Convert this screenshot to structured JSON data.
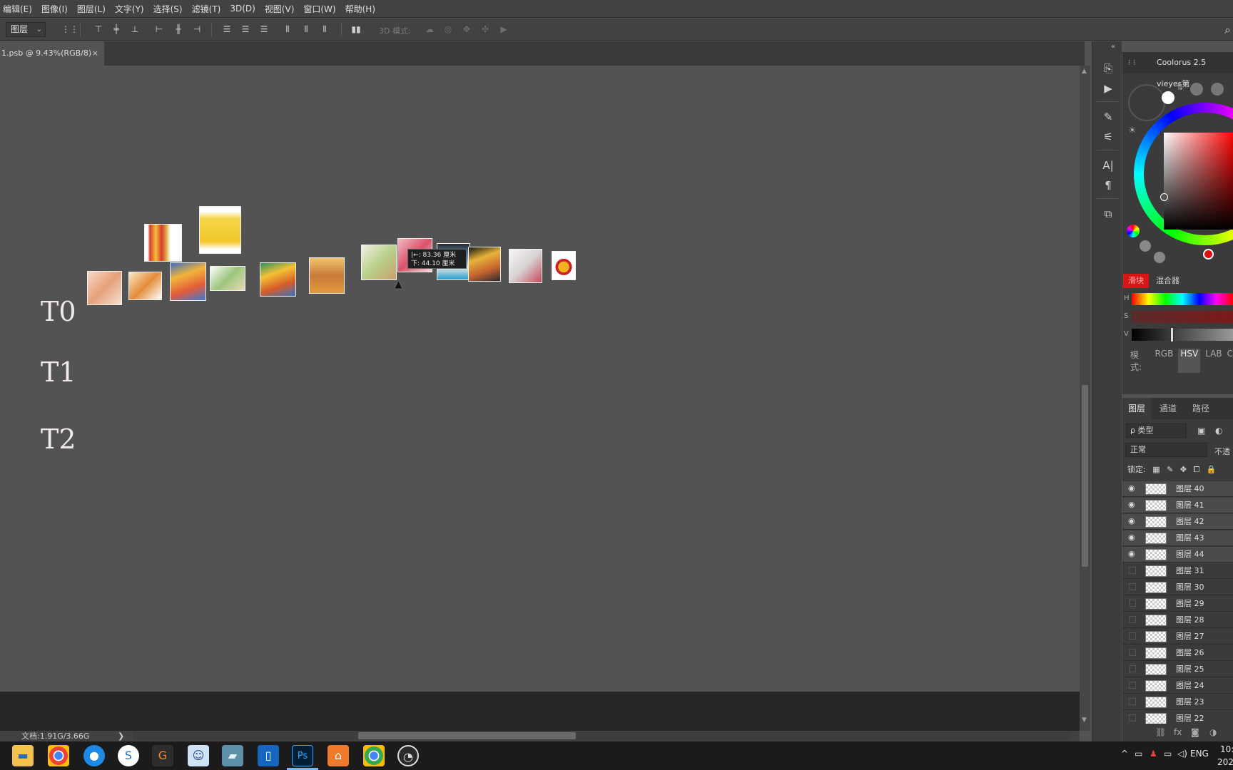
{
  "menu": [
    "编辑(E)",
    "图像(I)",
    "图层(L)",
    "文字(Y)",
    "选择(S)",
    "滤镜(T)",
    "3D(D)",
    "视图(V)",
    "窗口(W)",
    "帮助(H)"
  ],
  "options": {
    "auto_select_target": "图层",
    "mode_3d_label": "3D 模式:"
  },
  "document": {
    "tab_title": "1.psb @ 9.43%(RGB/8)",
    "close_glyph": "×"
  },
  "canvas": {
    "labels": [
      "T0",
      "T1",
      "T2"
    ],
    "tooltip_line1": "|←: 83.36 厘米",
    "tooltip_line2": "下: 44.10 厘米"
  },
  "status": {
    "doc_size": "文档:1.91G/3.66G"
  },
  "color_panel": {
    "title": "Coolorus 2.5 vieyes第",
    "tab_slider": "滑块",
    "tab_mixer": "混合器",
    "slider_labels": [
      "H",
      "S",
      "V"
    ],
    "mode_label": "模式:",
    "modes": [
      "RGB",
      "HSV",
      "LAB",
      "C"
    ],
    "accent": "#d81616"
  },
  "layers_panel": {
    "tabs": [
      "图层",
      "通道",
      "路径"
    ],
    "filter": "ρ 类型",
    "blend_mode": "正常",
    "opacity_label": "不透",
    "lock_label": "锁定:",
    "layers": [
      {
        "name": "图层 40",
        "visible": true
      },
      {
        "name": "图层 41",
        "visible": true
      },
      {
        "name": "图层 42",
        "visible": true
      },
      {
        "name": "图层 43",
        "visible": true
      },
      {
        "name": "图层 44",
        "visible": true
      },
      {
        "name": "图层 31",
        "visible": false
      },
      {
        "name": "图层 30",
        "visible": false
      },
      {
        "name": "图层 29",
        "visible": false
      },
      {
        "name": "图层 28",
        "visible": false
      },
      {
        "name": "图层 27",
        "visible": false
      },
      {
        "name": "图层 26",
        "visible": false
      },
      {
        "name": "图层 25",
        "visible": false
      },
      {
        "name": "图层 24",
        "visible": false
      },
      {
        "name": "图层 23",
        "visible": false
      },
      {
        "name": "图层 22",
        "visible": false
      }
    ]
  },
  "taskbar": {
    "apps": [
      "file-explorer",
      "chrome",
      "app-blue",
      "sogou",
      "grammarly",
      "game-app",
      "notes-app",
      "tablet-app",
      "photoshop",
      "shop-app",
      "chrome-profile",
      "obs"
    ],
    "tray_lang": "ENG",
    "clock_time": "10:",
    "clock_date": "202"
  }
}
